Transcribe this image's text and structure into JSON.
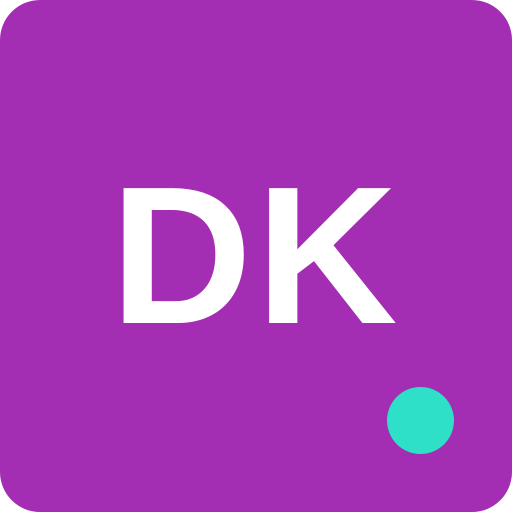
{
  "avatar": {
    "initials": "DK",
    "background_color": "#A32EB3",
    "text_color": "#FFFFFF",
    "status_indicator": {
      "icon": "online-status-dot-icon",
      "color": "#2EE0C7"
    }
  }
}
